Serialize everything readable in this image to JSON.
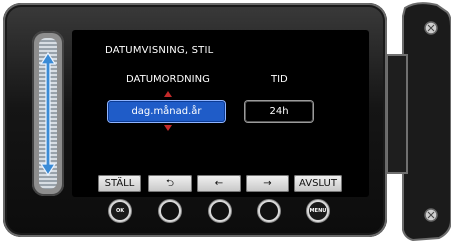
{
  "menu": {
    "title": "DATUMVISNING, STIL",
    "columns": {
      "date_order_label": "DATUMORDNING",
      "time_label": "TID"
    },
    "date_order_value": "dag.månad.år",
    "time_value": "24h"
  },
  "softkeys": {
    "set": "STÄLL",
    "back_glyph": "⮌",
    "left_glyph": "←",
    "right_glyph": "→",
    "exit": "AVSLUT"
  },
  "buttons": {
    "ok": "OK",
    "menu": "MENU"
  },
  "colors": {
    "selected_field": "#1f5cc8",
    "arrow": "#c42a2a"
  }
}
